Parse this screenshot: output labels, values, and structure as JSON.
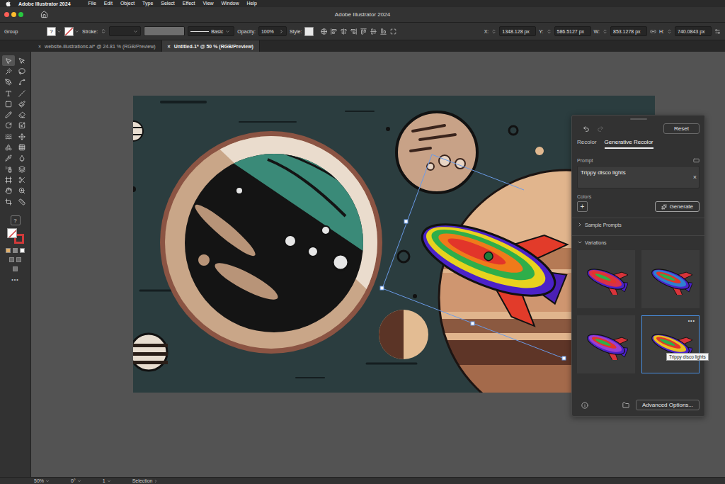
{
  "menu_bar": {
    "app": "Adobe Illustrator 2024",
    "items": [
      "File",
      "Edit",
      "Object",
      "Type",
      "Select",
      "Effect",
      "View",
      "Window",
      "Help"
    ]
  },
  "window": {
    "title": "Adobe Illustrator 2024"
  },
  "control_bar": {
    "selection": "Group",
    "fill": "?",
    "stroke_label": "Stroke:",
    "brush": "Basic",
    "opacity_label": "Opacity:",
    "opacity": "100%",
    "style_label": "Style:",
    "fields": [
      {
        "label": "X:",
        "value": "1348.128 px"
      },
      {
        "label": "Y:",
        "value": "586.5127 px"
      },
      {
        "label": "W:",
        "value": "853.1278 px"
      },
      {
        "label": "H:",
        "value": "740.0843 px"
      }
    ]
  },
  "document_tabs": [
    {
      "label": "website-illustrations.ai* @ 24.81 % (RGB/Preview)",
      "close": "×",
      "selected": false
    },
    {
      "label": "Untitled-1* @ 50 % (RGB/Preview)",
      "close": "×",
      "selected": true
    }
  ],
  "toolbar": {
    "tools": [
      {
        "selected": true
      },
      {
        "selected": false
      },
      {
        "selected": false
      },
      {
        "selected": false
      },
      {
        "selected": false
      },
      {
        "selected": false
      },
      {
        "selected": false
      },
      {
        "selected": false
      },
      {
        "selected": false
      },
      {
        "selected": false
      },
      {
        "selected": false
      },
      {
        "selected": false
      },
      {
        "selected": false
      },
      {
        "selected": false
      },
      {
        "selected": false
      },
      {
        "selected": false
      },
      {
        "selected": false
      },
      {
        "selected": false
      },
      {
        "selected": false
      },
      {
        "selected": false
      },
      {
        "selected": false
      },
      {
        "selected": false
      },
      {
        "selected": false
      },
      {
        "selected": false
      },
      {
        "selected": false
      },
      {
        "selected": false
      },
      {
        "selected": false
      },
      {
        "selected": false
      }
    ],
    "help": "?",
    "more": "•••"
  },
  "recolor_panel": {
    "history": {
      "undo_enabled": true,
      "redo_enabled": false
    },
    "reset": "Reset",
    "tabs": [
      {
        "label": "Recolor",
        "selected": false
      },
      {
        "label": "Generative Recolor",
        "selected": true
      }
    ],
    "prompt_label": "Prompt",
    "prompt": "Trippy disco lights",
    "clear": "×",
    "colors_label": "Colors",
    "add": "+",
    "generate": "Generate",
    "sections": [
      {
        "label": "Sample Prompts",
        "expanded": false
      },
      {
        "label": "Variations",
        "expanded": true
      }
    ],
    "variations": [
      {
        "selected": false,
        "color": "#d9304a"
      },
      {
        "selected": false,
        "color": "#2f7fd0"
      },
      {
        "selected": false,
        "color": "#9b3fd0"
      },
      {
        "selected": true,
        "color": "#e8c020"
      }
    ],
    "more": "•••",
    "tooltip": "Trippy disco lights",
    "advanced": "Advanced Options..."
  },
  "status_bar": {
    "zoom": "50%",
    "rotation": "0°",
    "artboard": "1",
    "tool": "Selection"
  }
}
